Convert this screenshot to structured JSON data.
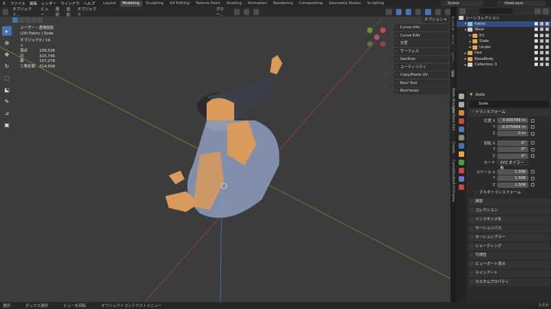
{
  "menu": [
    "ファイル",
    "編集",
    "レンダー",
    "ウィンドウ",
    "ヘルプ"
  ],
  "workspaces": [
    {
      "label": "Layout",
      "active": false
    },
    {
      "label": "Modeling",
      "active": true
    },
    {
      "label": "Sculpting",
      "active": false
    },
    {
      "label": "UV Editing",
      "active": false
    },
    {
      "label": "Texture Paint",
      "active": false
    },
    {
      "label": "Shading",
      "active": false
    },
    {
      "label": "Animation",
      "active": false
    },
    {
      "label": "Rendering",
      "active": false
    },
    {
      "label": "Compositing",
      "active": false
    },
    {
      "label": "Geometry Nodes",
      "active": false
    },
    {
      "label": "Scripting",
      "active": false
    }
  ],
  "scene": "Scene",
  "view_layer": "ViewLayer",
  "viewport": {
    "mode": "オブジェクト...",
    "menus": [
      "ビュー",
      "選択",
      "追加",
      "オブジェクト"
    ],
    "orientation": "グロー..."
  },
  "stats": {
    "view": "ユーザー・透視投影",
    "object_line": "(29) Fabric | Sode",
    "rows": [
      {
        "label": "オブジェクト",
        "value": "0 / 19"
      },
      {
        "label": "頂点",
        "value": "158,526"
      },
      {
        "label": "辺",
        "value": "315,746"
      },
      {
        "label": "面",
        "value": "157,279"
      },
      {
        "label": "三角形面",
        "value": "314,558"
      }
    ]
  },
  "npanel": {
    "options": "オプション ▾",
    "items": [
      "Curve Info",
      "Curve Edit",
      "交差",
      "サーフェス",
      "Sanitize",
      "ユーティリティ",
      "Copy/Paste UV",
      "Bool Tool",
      "Bsurfaces"
    ]
  },
  "npanel_tabs": [
    "アイテム",
    "ツール",
    "ビュー",
    "編集",
    "Node Wrangler",
    "LoopTools",
    "Edit",
    "Create",
    "CurveDonNotEditDisplay"
  ],
  "outliner": {
    "root": "シーンコレクション",
    "rows": [
      {
        "name": "Fabric",
        "indent": 1,
        "selected": true,
        "color": "#7ec8e3"
      },
      {
        "name": "Wear",
        "indent": 1,
        "selected": false,
        "color": "#d0d0d0"
      },
      {
        "name": "Eri",
        "indent": 2,
        "selected": false,
        "color": "#e3a84b"
      },
      {
        "name": "Sode",
        "indent": 2,
        "selected": false,
        "color": "#e3a84b"
      },
      {
        "name": "Under",
        "indent": 2,
        "selected": false,
        "color": "#e3a84b"
      },
      {
        "name": "Hair",
        "indent": 1,
        "selected": false,
        "color": "#e3a84b"
      },
      {
        "name": "BaseBody",
        "indent": 1,
        "selected": false,
        "color": "#e3a84b"
      },
      {
        "name": "Collection 3",
        "indent": 1,
        "selected": false,
        "color": "#d0d0d0"
      }
    ]
  },
  "properties": {
    "object_name": "Sode",
    "name_field": "Sode",
    "transform_header": "トランスフォーム",
    "location": [
      {
        "label": "位置 X",
        "value": "0.000786 m"
      },
      {
        "label": "Y",
        "value": "-0.075664 m"
      },
      {
        "label": "Z",
        "value": "0 m"
      }
    ],
    "rotation": [
      {
        "label": "回転 X",
        "value": "0°"
      },
      {
        "label": "Y",
        "value": "0°"
      },
      {
        "label": "Z",
        "value": "0°"
      }
    ],
    "mode": {
      "label": "モード",
      "value": "XYZ オイラー角"
    },
    "scale": [
      {
        "label": "スケール X",
        "value": "1.508"
      },
      {
        "label": "Y",
        "value": "1.508"
      },
      {
        "label": "Z",
        "value": "1.508"
      }
    ],
    "delta": "デルタトランスフォーム",
    "sections": [
      "関係",
      "コレクション",
      "インスタンス化",
      "モーションパス",
      "モーションブラー",
      "シェーディング",
      "可視性",
      "ビューポート表示",
      "ラインアート",
      "カスタムプロパティ"
    ]
  },
  "status": [
    "選択",
    "ボックス選択",
    "ビューを回転",
    "オブジェクトコンテクストメニュー"
  ],
  "version": "3.0.0",
  "colors": {
    "accent": "#4772b3",
    "selected_row": "#334d80",
    "x_axis": "#b34d4d",
    "y_axis": "#8aa62e",
    "z_axis": "#4d7ab3"
  }
}
